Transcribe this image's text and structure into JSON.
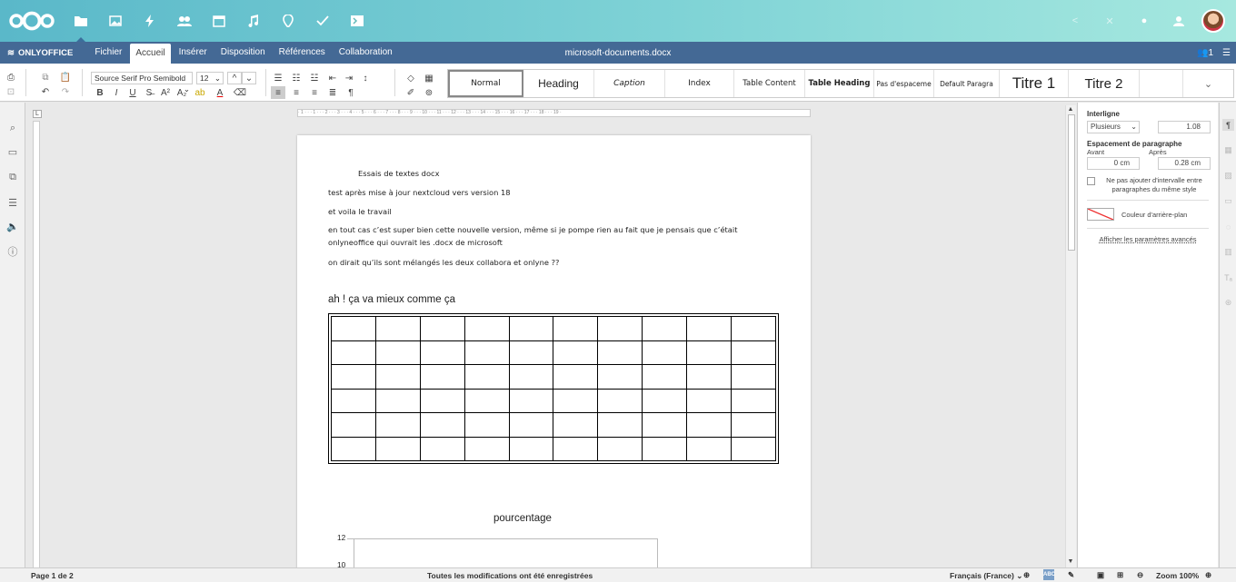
{
  "nextcloud": {
    "apps": [
      "files-icon",
      "photos-icon",
      "activity-icon",
      "contacts-icon",
      "calendar-icon",
      "music-icon",
      "maps-icon",
      "tasks-icon",
      "terminal-icon"
    ],
    "right_icons": [
      "share-icon",
      "close-icon",
      "notifications-icon",
      "contacts-menu-icon"
    ]
  },
  "header": {
    "logo": "ONLYOFFICE",
    "tabs": [
      "Fichier",
      "Accueil",
      "Insérer",
      "Disposition",
      "Références",
      "Collaboration"
    ],
    "active_tab": "Accueil",
    "doc_title": "microsoft-documents.docx",
    "users_count": "1"
  },
  "toolbar": {
    "font_name": "Source Serif Pro Semibold",
    "font_size": "12",
    "styles": [
      "Normal",
      "Heading",
      "Caption",
      "Index",
      "Table Content",
      "Table Heading",
      "Pas d'espaceme",
      "Default Paragra",
      "Titre 1",
      "Titre 2",
      ""
    ]
  },
  "ruler": {
    "h_marks": "· 1 · · · 1 · · · 2 · · · 3 · · · 4 · · · 5 · · · 6 · · · 7 · · · 8 · · · 9 · · · 10 · · · 11 · · · 12 · · · 13 · · · 14 · · · 15 · · · 16 · · · 17 · · · 18 · · · 19 ·"
  },
  "document": {
    "lines": [
      "Essais de textes docx",
      "test après mise à jour nextcloud vers version 18",
      "et voila le travail",
      " en tout cas c’est super bien cette nouvelle version, même si je pompe rien au fait que je pensais que c’était",
      "onlyneoffice qui ouvrait les .docx de microsoft",
      "on dirait qu’ils sont mélangés les deux collabora et onlyne ??"
    ],
    "ah_line": "ah !  ça va mieux comme ça",
    "table": {
      "rows": 6,
      "cols": 10
    },
    "chart_title": "pourcentage",
    "chart_ticks": [
      "12",
      "10"
    ]
  },
  "right_panel": {
    "interligne_label": "Interligne",
    "interligne_mode": "Plusieurs",
    "interligne_value": "1.08",
    "spacing_label": "Espacement de paragraphe",
    "before_label": "Avant",
    "after_label": "Après",
    "before_value": "0 cm",
    "after_value": "0.28 cm",
    "checkbox_label": "Ne pas ajouter d'intervalle entre paragraphes du même style",
    "bg_color_label": "Couleur d'arrière-plan",
    "advanced_label": "Afficher les paramètres avancés"
  },
  "status": {
    "page": "Page 1 de 2",
    "saved": "Toutes les modifications ont été enregistrées",
    "language": "Français (France)",
    "zoom": "Zoom 100%"
  }
}
